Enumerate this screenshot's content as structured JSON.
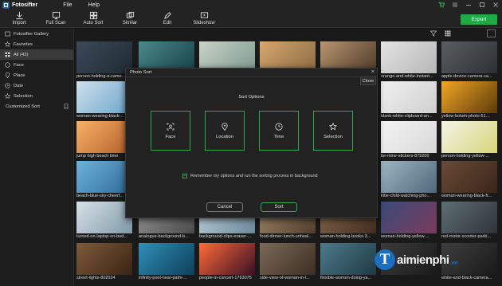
{
  "app": {
    "name": "Fotosifter",
    "menus": [
      "File",
      "Help"
    ]
  },
  "toolbar": {
    "tools": [
      {
        "label": "Import",
        "icon": "import-icon"
      },
      {
        "label": "Full Scan",
        "icon": "full-scan-icon"
      },
      {
        "label": "Auto Sort",
        "icon": "auto-sort-icon"
      },
      {
        "label": "Similar",
        "icon": "similar-icon"
      },
      {
        "label": "Edit",
        "icon": "edit-icon"
      },
      {
        "label": "Slideshow",
        "icon": "slideshow-icon"
      }
    ],
    "export_label": "Export"
  },
  "sidebar": {
    "items": [
      {
        "label": "Fotosifter Gallery",
        "icon": "gallery-icon"
      },
      {
        "label": "Favorites",
        "icon": "star-icon"
      },
      {
        "label": "All (42)",
        "icon": "grid-icon"
      },
      {
        "label": "Face",
        "icon": "face-icon"
      },
      {
        "label": "Place",
        "icon": "pin-icon"
      },
      {
        "label": "Date",
        "icon": "clock-icon"
      },
      {
        "label": "Selection",
        "icon": "star-outline-icon"
      }
    ],
    "custom_sort": "Customized Sort"
  },
  "grid": {
    "rows": [
      [
        "person-holding-a-came...",
        "",
        "",
        "",
        "",
        "orange-and-white-instant...",
        "apple-device-camera-ca..."
      ],
      [
        "woman-wearing-black-...",
        "",
        "",
        "",
        "",
        "blank-white-clipboard-an...",
        "yellow-bokeh-photo-51..."
      ],
      [
        "jump high beach time",
        "",
        "",
        "",
        "",
        "be-mine-stickers-879200",
        "person-holding-yellow-..."
      ],
      [
        "beach-blue-sky-cheerf...",
        "",
        "",
        "",
        "",
        "little-child-watching-pho...",
        "woman-wearing-black-fr..."
      ],
      [
        "turned-on-laptop-on-bed...",
        "analogue-background-b...",
        "background-clips-eraser-...",
        "food-dinner-lunch-unheal...",
        "woman-holding-books-3...",
        "woman-holding-yellow-...",
        "red-motor-scooter-parki..."
      ],
      [
        "street-lights-802024",
        "infinity-pool-near-palm-...",
        "people-in-concert-1763075",
        "side-view-of-woman-in-l...",
        "flexible-women-doing-ya...",
        "",
        "white-and-black-camera..."
      ]
    ]
  },
  "dialog": {
    "title": "Photo Sort",
    "close_tab": "Close",
    "heading": "Sort Options",
    "options": [
      {
        "label": "Face",
        "icon": "face-scan-icon"
      },
      {
        "label": "Location",
        "icon": "location-pin-icon"
      },
      {
        "label": "Time",
        "icon": "clock-icon"
      },
      {
        "label": "Selection",
        "icon": "star-outline-icon"
      }
    ],
    "remember": "Remember my options and run the sorting process in background",
    "cancel": "Cancel",
    "sort": "Sort"
  },
  "watermark": {
    "mark": "T",
    "text": "aimienphi",
    "suffix": ".vn"
  },
  "colors": {
    "accent": "#2ea84b",
    "export": "#1faa44",
    "background": "#1a1a1a"
  }
}
